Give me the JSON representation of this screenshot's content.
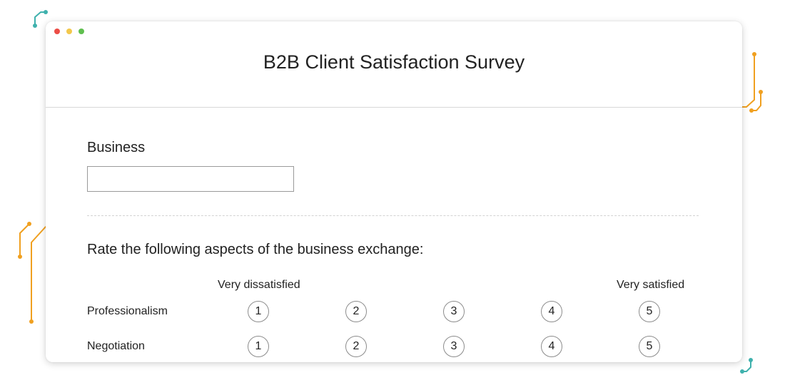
{
  "window": {
    "controls": [
      {
        "name": "close",
        "color": "#ec4d46"
      },
      {
        "name": "minimize",
        "color": "#f3c84c"
      },
      {
        "name": "maximize",
        "color": "#5fbf4f"
      }
    ]
  },
  "survey": {
    "title": "B2B Client Satisfaction Survey",
    "business": {
      "label": "Business",
      "value": "",
      "placeholder": ""
    },
    "rating": {
      "question": "Rate the following aspects of the business exchange:",
      "scale_low_label": "Very dissatisfied",
      "scale_high_label": "Very satisfied",
      "options": [
        "1",
        "2",
        "3",
        "4",
        "5"
      ],
      "rows": [
        {
          "label": "Professionalism",
          "selected": null
        },
        {
          "label": "Negotiation",
          "selected": null
        }
      ]
    }
  },
  "decoration": {
    "teal": "#3fb1ad",
    "orange": "#f0a020"
  }
}
